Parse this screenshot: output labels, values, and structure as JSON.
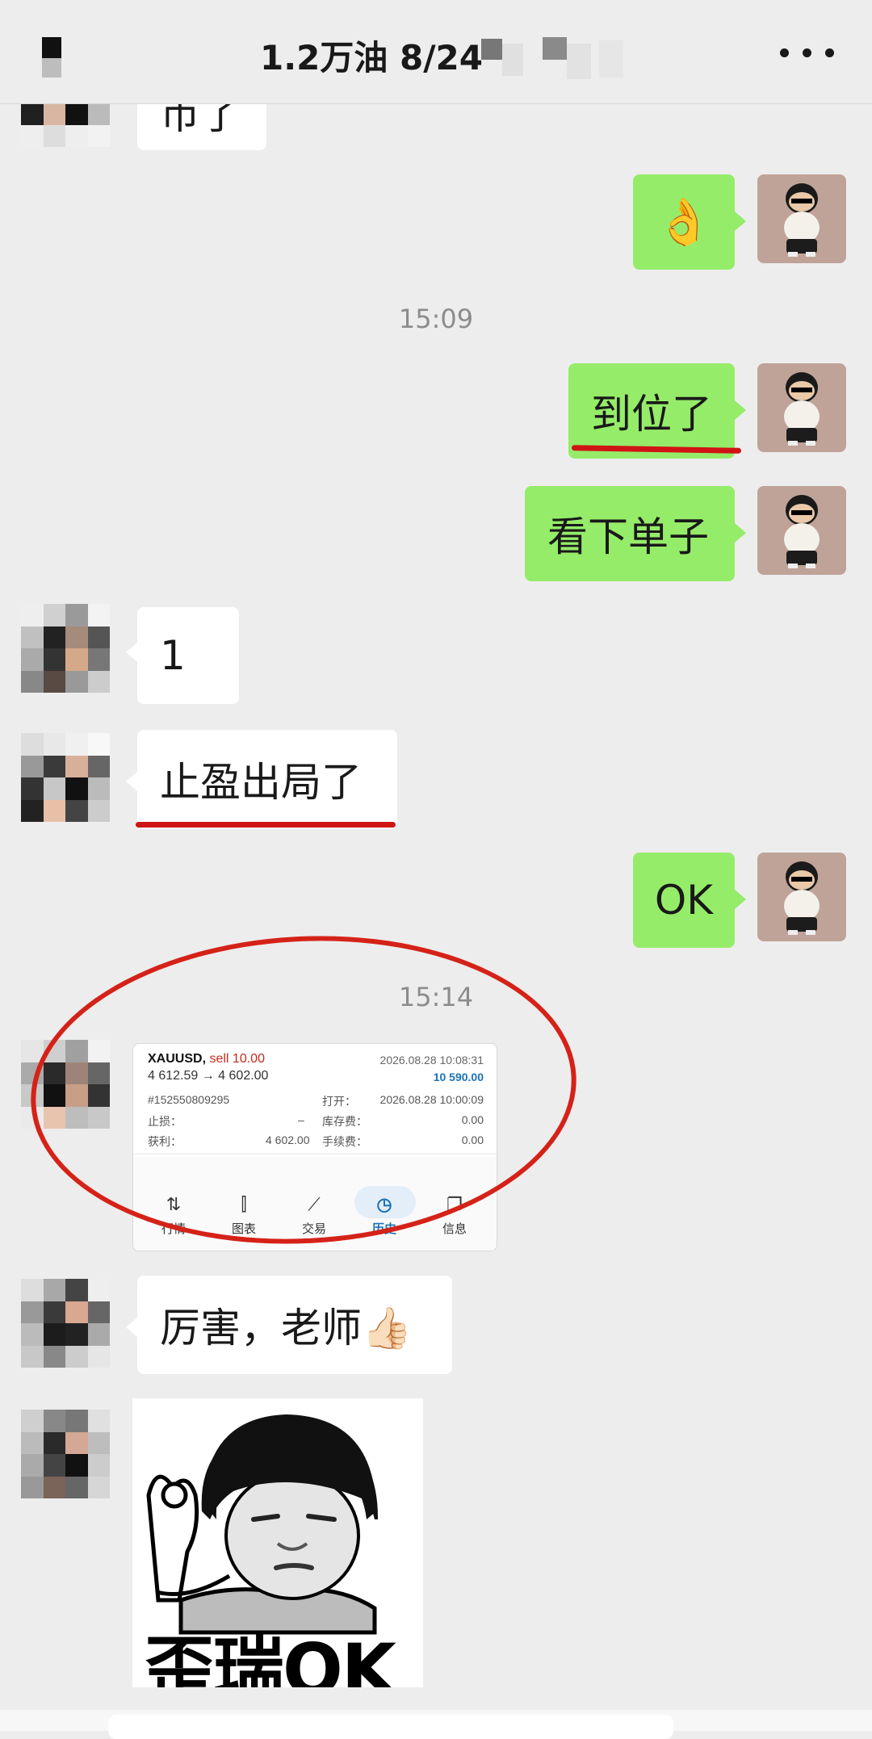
{
  "header": {
    "title": "1.2万油  8/24",
    "more_label": "···"
  },
  "messages": {
    "m0_text": "币了",
    "m1_emoji": "👌",
    "t1": "15:09",
    "m2_text": "到位了",
    "m3_text": "看下单子",
    "m4_text": "1",
    "m5_text": "止盈出局了",
    "m6_text": "OK",
    "t2": "15:14",
    "m8_text": "厉害，老师👍🏻",
    "sticker_caption": "歪瑞OK"
  },
  "trade": {
    "symbol": "XAUUSD,",
    "side": "sell 10.00",
    "prices": "4 612.59 → 4 602.00",
    "close_time": "2026.08.28 10:08:31",
    "profit_total": "10 590.00",
    "order_id": "#152550809295",
    "open_label": "打开：",
    "open_time": "2026.08.28 10:00:09",
    "sl_label": "止损：",
    "sl_value": "–",
    "swap_label": "库存费：",
    "swap_value": "0.00",
    "tp_label": "获利：",
    "tp_value": "4 602.00",
    "fee_label": "手续费：",
    "fee_value": "0.00",
    "nav": [
      "行情",
      "图表",
      "交易",
      "历史",
      "信息"
    ]
  },
  "colors": {
    "bubble_out": "#95ec69",
    "bubble_in": "#ffffff",
    "annotation_red": "#d01414",
    "trade_sell_red": "#c8281e",
    "trade_profit_blue": "#1a73b8"
  }
}
